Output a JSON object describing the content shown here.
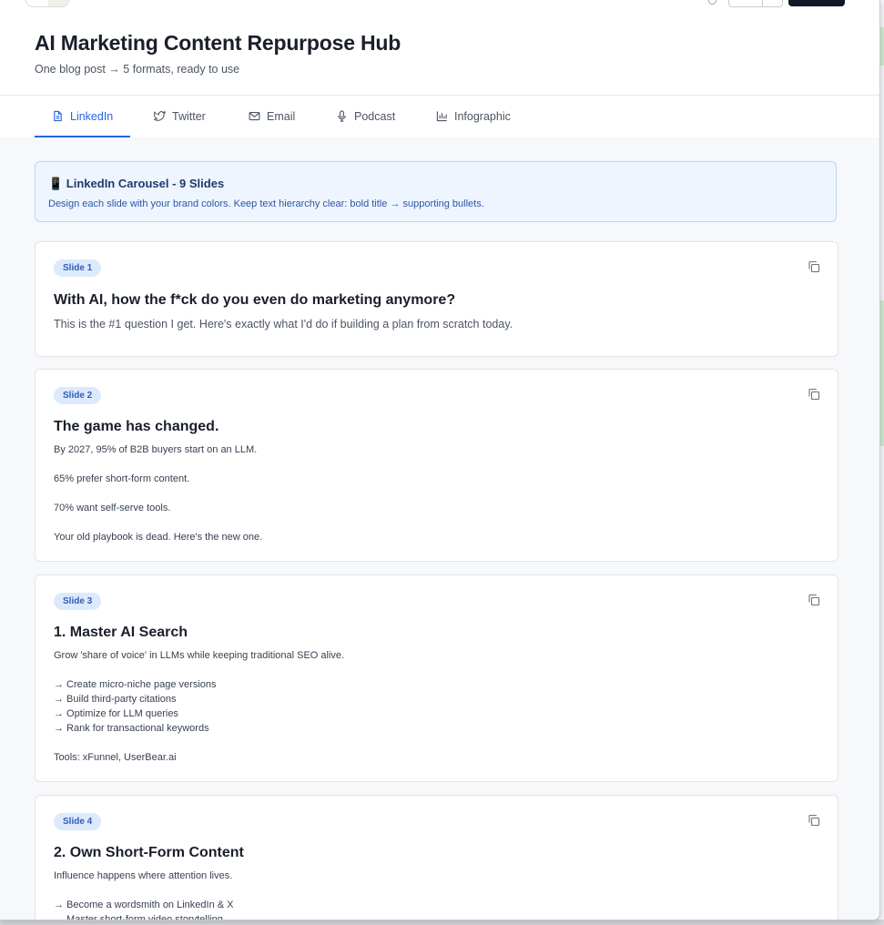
{
  "app": {
    "title": "AI Marketing Content Repurpose Hub",
    "subtitle": "One blog post → 5 formats, ready to use"
  },
  "tabs": [
    {
      "label": "LinkedIn",
      "icon": "document-icon",
      "active": true
    },
    {
      "label": "Twitter",
      "icon": "twitter-icon",
      "active": false
    },
    {
      "label": "Email",
      "icon": "mail-icon",
      "active": false
    },
    {
      "label": "Podcast",
      "icon": "microphone-icon",
      "active": false
    },
    {
      "label": "Infographic",
      "icon": "bar-chart-icon",
      "active": false
    }
  ],
  "banner": {
    "title": "📱 LinkedIn Carousel - 9 Slides",
    "text": "Design each slide with your brand colors. Keep text hierarchy clear: bold title → supporting bullets."
  },
  "slides": [
    {
      "badge": "Slide 1",
      "title": "With AI, how the f*ck do you even do marketing anymore?",
      "body": "This is the #1 question I get. Here's exactly what I'd do if building a plan from scratch today."
    },
    {
      "badge": "Slide 2",
      "title": "The game has changed.",
      "body": "By 2027, 95% of B2B buyers start on an LLM.\n\n65% prefer short-form content.\n\n70% want self-serve tools.\n\nYour old playbook is dead. Here's the new one."
    },
    {
      "badge": "Slide 3",
      "title": "1. Master AI Search",
      "body": "Grow 'share of voice' in LLMs while keeping traditional SEO alive.\n\n→ Create micro-niche page versions\n→ Build third-party citations\n→ Optimize for LLM queries\n→ Rank for transactional keywords\n\nTools: xFunnel, UserBear.ai"
    },
    {
      "badge": "Slide 4",
      "title": "2. Own Short-Form Content",
      "body": "Influence happens where attention lives.\n\n→ Become a wordsmith on LinkedIn & X\n→ Master short-form video storytelling"
    }
  ],
  "colors": {
    "accent": "#2563eb",
    "banner_bg": "#eef5ff",
    "badge_bg": "#dde9fc",
    "title_text": "#1a1f2b"
  }
}
